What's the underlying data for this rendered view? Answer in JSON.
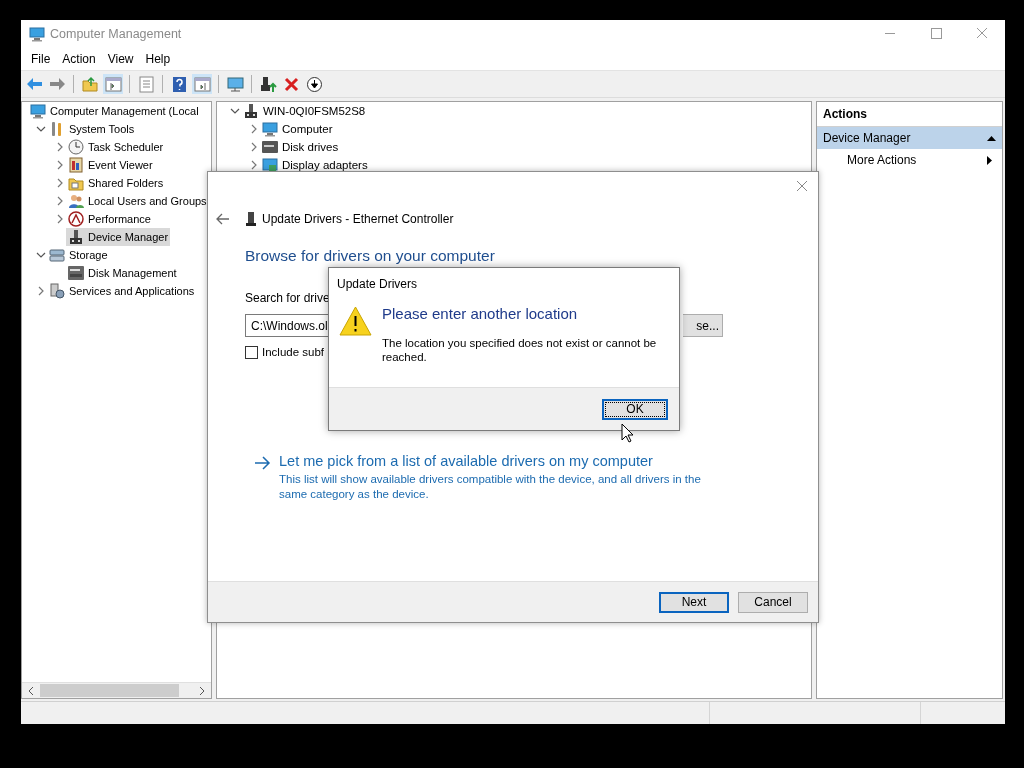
{
  "window": {
    "title": "Computer Management"
  },
  "menu": [
    "File",
    "Action",
    "View",
    "Help"
  ],
  "console_tree": {
    "items": [
      {
        "label": "Computer Management (Local",
        "selected": false,
        "children": [
          {
            "label": "System Tools",
            "expanded": true,
            "selected": false,
            "children": [
              {
                "label": "Task Scheduler",
                "expanded": false,
                "selected": false
              },
              {
                "label": "Event Viewer",
                "expanded": false,
                "selected": false
              },
              {
                "label": "Shared Folders",
                "expanded": false,
                "selected": false
              },
              {
                "label": "Local Users and Groups",
                "expanded": false,
                "selected": false
              },
              {
                "label": "Performance",
                "expanded": false,
                "selected": false
              },
              {
                "label": "Device Manager",
                "selected": true
              }
            ]
          },
          {
            "label": "Storage",
            "expanded": true,
            "selected": false,
            "children": [
              {
                "label": "Disk Management",
                "selected": false
              }
            ]
          },
          {
            "label": "Services and Applications",
            "expanded": false,
            "selected": false
          }
        ]
      }
    ]
  },
  "device_tree": {
    "items": [
      {
        "label": "WIN-0QI0FSM52S8",
        "expanded": true,
        "children": [
          {
            "label": "Computer",
            "expanded": false
          },
          {
            "label": "Disk drives",
            "expanded": false
          },
          {
            "label": "Display adapters",
            "expanded": false
          }
        ]
      }
    ]
  },
  "actions": {
    "header": "Actions",
    "section": {
      "label": "Device Manager",
      "expanded": true
    },
    "items": [
      "More Actions"
    ]
  },
  "wizard": {
    "title": "Update Drivers - Ethernet Controller",
    "heading": "Browse for drivers on your computer",
    "search_label": "Search for drive",
    "path_field": {
      "value": "C:\\Windows.ol"
    },
    "include_subfolders": {
      "label": "Include subf",
      "checked": false
    },
    "browse_button": "se...",
    "pick_link": {
      "label": "Let me pick from a list of available drivers on my computer",
      "description": "This list will show available drivers compatible with the device, and all drivers in the same category as the device."
    },
    "buttons": [
      {
        "label": "Next",
        "default": true
      },
      {
        "label": "Cancel",
        "default": false
      }
    ]
  },
  "message_box": {
    "title": "Update Drivers",
    "heading": "Please enter another location",
    "message": "The location you specified does not exist or cannot be reached.",
    "buttons": [
      {
        "label": "OK",
        "focused": true
      }
    ]
  }
}
